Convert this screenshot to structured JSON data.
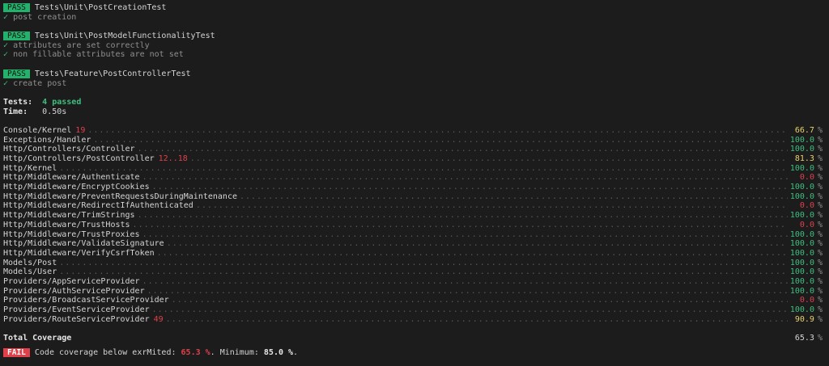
{
  "tests": [
    {
      "badge": "PASS",
      "suite": "Tests\\Unit\\PostCreationTest",
      "cases": [
        "post creation"
      ]
    },
    {
      "badge": "PASS",
      "suite": "Tests\\Unit\\PostModelFunctionalityTest",
      "cases": [
        "attributes are set correctly",
        "non fillable attributes are not set"
      ]
    },
    {
      "badge": "PASS",
      "suite": "Tests\\Feature\\PostControllerTest",
      "cases": [
        "create post"
      ]
    }
  ],
  "check_mark": "✓",
  "summary": {
    "tests_label": "Tests:",
    "tests_value": "4 passed",
    "time_label": "Time:",
    "time_value": "0.50s"
  },
  "coverage": [
    {
      "name": "Console/Kernel",
      "lines": "19",
      "pct": "66.7",
      "level": "yellow"
    },
    {
      "name": "Exceptions/Handler",
      "lines": "",
      "pct": "100.0",
      "level": "green"
    },
    {
      "name": "Http/Controllers/Controller",
      "lines": "",
      "pct": "100.0",
      "level": "green"
    },
    {
      "name": "Http/Controllers/PostController",
      "lines": "12..18",
      "pct": "81.3",
      "level": "yellow"
    },
    {
      "name": "Http/Kernel",
      "lines": "",
      "pct": "100.0",
      "level": "green"
    },
    {
      "name": "Http/Middleware/Authenticate",
      "lines": "",
      "pct": "0.0",
      "level": "red"
    },
    {
      "name": "Http/Middleware/EncryptCookies",
      "lines": "",
      "pct": "100.0",
      "level": "green"
    },
    {
      "name": "Http/Middleware/PreventRequestsDuringMaintenance",
      "lines": "",
      "pct": "100.0",
      "level": "green"
    },
    {
      "name": "Http/Middleware/RedirectIfAuthenticated",
      "lines": "",
      "pct": "0.0",
      "level": "red"
    },
    {
      "name": "Http/Middleware/TrimStrings",
      "lines": "",
      "pct": "100.0",
      "level": "green"
    },
    {
      "name": "Http/Middleware/TrustHosts",
      "lines": "",
      "pct": "0.0",
      "level": "red"
    },
    {
      "name": "Http/Middleware/TrustProxies",
      "lines": "",
      "pct": "100.0",
      "level": "green"
    },
    {
      "name": "Http/Middleware/ValidateSignature",
      "lines": "",
      "pct": "100.0",
      "level": "green"
    },
    {
      "name": "Http/Middleware/VerifyCsrfToken",
      "lines": "",
      "pct": "100.0",
      "level": "green"
    },
    {
      "name": "Models/Post",
      "lines": "",
      "pct": "100.0",
      "level": "green"
    },
    {
      "name": "Models/User",
      "lines": "",
      "pct": "100.0",
      "level": "green"
    },
    {
      "name": "Providers/AppServiceProvider",
      "lines": "",
      "pct": "100.0",
      "level": "green"
    },
    {
      "name": "Providers/AuthServiceProvider",
      "lines": "",
      "pct": "100.0",
      "level": "green"
    },
    {
      "name": "Providers/BroadcastServiceProvider",
      "lines": "",
      "pct": "0.0",
      "level": "red"
    },
    {
      "name": "Providers/EventServiceProvider",
      "lines": "",
      "pct": "100.0",
      "level": "green"
    },
    {
      "name": "Providers/RouteServiceProvider",
      "lines": "49",
      "pct": "90.9",
      "level": "yellow"
    }
  ],
  "pct_unit": "%",
  "total": {
    "label": "Total Coverage",
    "pct": "65.3",
    "unit": "%"
  },
  "failure": {
    "badge": "FAIL",
    "message_prefix": "Code coverage below exrMited:",
    "actual": "65.3 %",
    "middle": ". Minimum:",
    "minimum": "85.0 %",
    "suffix": "."
  },
  "colors": {
    "background": "#1c1c1c",
    "pass": "#23b26b",
    "fail": "#e0404a",
    "green": "#3fbf7f",
    "yellow": "#e6d26b",
    "red": "#e0404a"
  }
}
